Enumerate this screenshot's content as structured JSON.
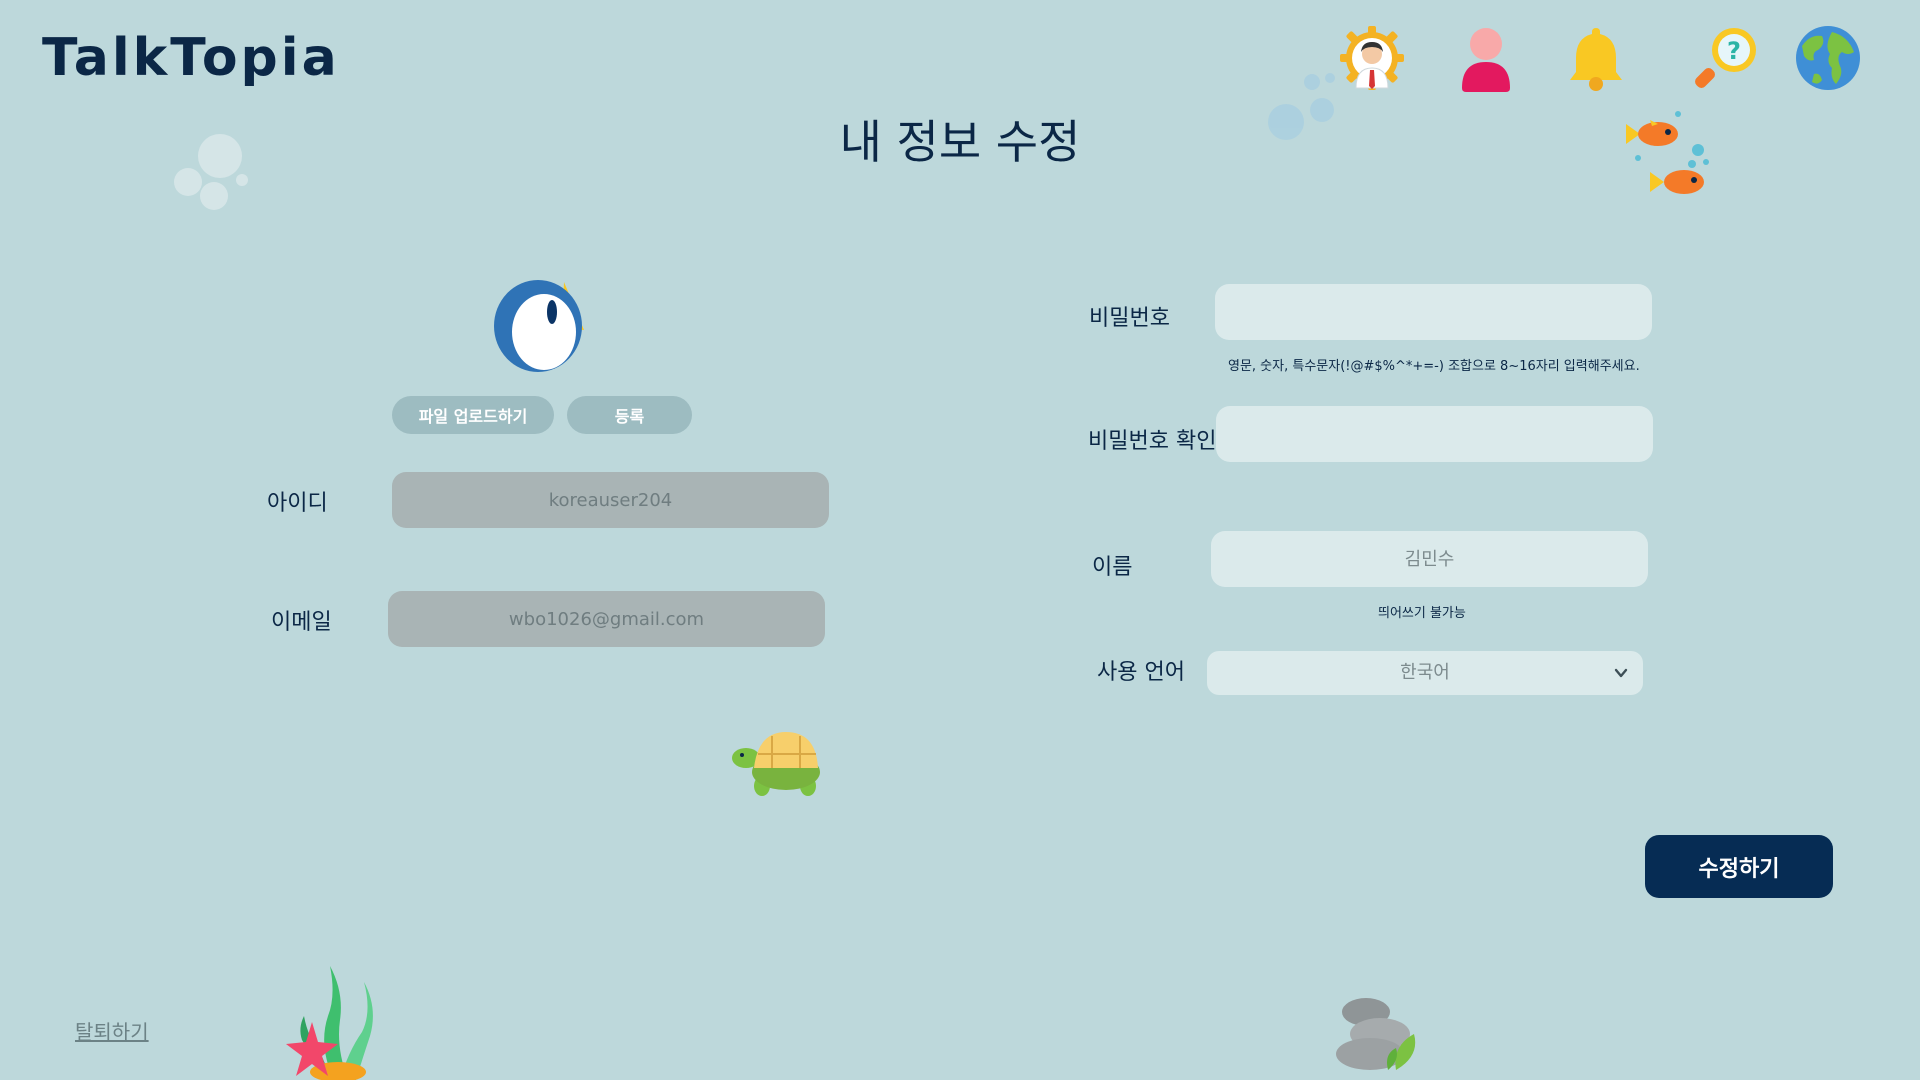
{
  "header": {
    "logo": "TalkTopia",
    "icons": [
      {
        "name": "settings-profile-icon"
      },
      {
        "name": "user-icon"
      },
      {
        "name": "bell-icon"
      },
      {
        "name": "help-search-icon"
      },
      {
        "name": "globe-icon"
      }
    ]
  },
  "page": {
    "title": "내 정보 수정"
  },
  "profile": {
    "upload_label": "파일 업로드하기",
    "register_label": "등록"
  },
  "left_form": {
    "id_label": "아이디",
    "id_value": "koreauser204",
    "email_label": "이메일",
    "email_value": "wbo1026@gmail.com"
  },
  "right_form": {
    "password_label": "비밀번호",
    "password_value": "",
    "password_hint": "영문, 숫자, 특수문자(!@#$%^*+=-) 조합으로 8~16자리 입력해주세요.",
    "password_confirm_label": "비밀번호 확인",
    "password_confirm_value": "",
    "name_label": "이름",
    "name_placeholder": "김민수",
    "name_hint": "띄어쓰기 불가능",
    "language_label": "사용 언어",
    "language_selected": "한국어"
  },
  "actions": {
    "submit_label": "수정하기",
    "withdraw_label": "탈퇴하기"
  },
  "colors": {
    "background": "#bdd8db",
    "primary": "#062c54",
    "readonly_field": "#a9b4b5",
    "editable_field": "#dbeaeb",
    "pill_button": "#9dbcc1"
  }
}
